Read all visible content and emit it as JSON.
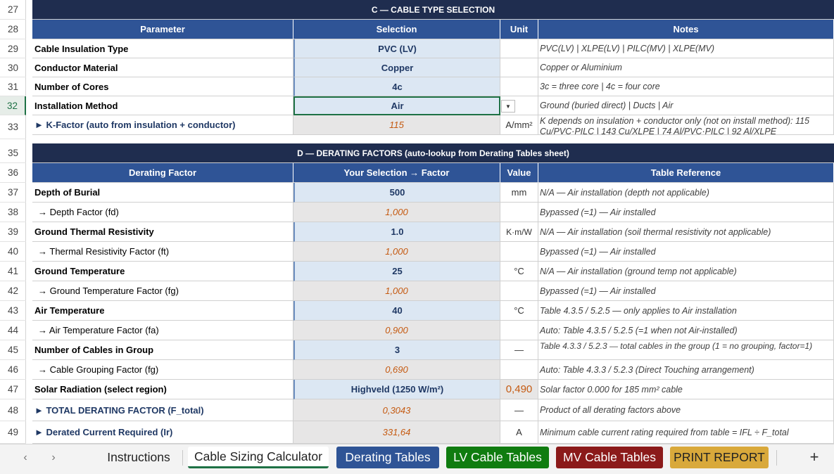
{
  "row_numbers": [
    "27",
    "28",
    "29",
    "30",
    "31",
    "32",
    "33",
    "35",
    "36",
    "37",
    "38",
    "39",
    "40",
    "41",
    "42",
    "43",
    "44",
    "45",
    "46",
    "47",
    "48",
    "49"
  ],
  "section_c": {
    "title": "C  —  CABLE TYPE SELECTION",
    "headers": [
      "Parameter",
      "Selection",
      "Unit",
      "Notes"
    ],
    "rows": [
      {
        "param": "Cable Insulation Type",
        "selection": "PVC (LV)",
        "unit": "",
        "notes": "PVC(LV) | XLPE(LV) | PILC(MV) | XLPE(MV)"
      },
      {
        "param": "Conductor Material",
        "selection": "Copper",
        "unit": "",
        "notes": "Copper or Aluminium"
      },
      {
        "param": "Number of Cores",
        "selection": "4c",
        "unit": "",
        "notes": "3c = three core  |  4c = four core"
      },
      {
        "param": "Installation Method",
        "selection": "Air",
        "unit": "",
        "notes": "Ground (buried direct)  |  Ducts  |  Air"
      },
      {
        "param": "► K-Factor  (auto from insulation + conductor)",
        "selection": "115",
        "unit": "A/mm²",
        "notes": "K depends on insulation + conductor only (not on install method):  115 Cu/PVC·PILC  |  143 Cu/XLPE  |  74 Al/PVC·PILC  |  92 Al/XLPE"
      }
    ]
  },
  "section_d": {
    "title": "D  —  DERATING FACTORS  (auto-lookup from Derating Tables sheet)",
    "headers": [
      "Derating Factor",
      "Your Selection → Factor",
      "Value",
      "Table Reference"
    ],
    "rows": [
      {
        "param": "Depth of Burial",
        "selection": "500",
        "unit": "mm",
        "notes": "N/A — Air installation (depth not applicable)",
        "kind": "input"
      },
      {
        "param": "→ Depth Factor  (fd)",
        "selection": "1,000",
        "unit": "",
        "notes": "Bypassed (=1) — Air installed",
        "kind": "calc"
      },
      {
        "param": "Ground Thermal Resistivity",
        "selection": "1.0",
        "unit": "K·m/W",
        "notes": "N/A — Air installation (soil thermal resistivity not applicable)",
        "kind": "input"
      },
      {
        "param": "→ Thermal Resistivity Factor  (ft)",
        "selection": "1,000",
        "unit": "",
        "notes": "Bypassed (=1) — Air installed",
        "kind": "calc"
      },
      {
        "param": "Ground Temperature",
        "selection": "25",
        "unit": "°C",
        "notes": "N/A — Air installation (ground temp not applicable)",
        "kind": "input"
      },
      {
        "param": "→ Ground Temperature Factor  (fg)",
        "selection": "1,000",
        "unit": "",
        "notes": "Bypassed (=1) — Air installed",
        "kind": "calc"
      },
      {
        "param": "Air Temperature",
        "selection": "40",
        "unit": "°C",
        "notes": "Table 4.3.5 / 5.2.5 — only applies to Air installation",
        "kind": "input"
      },
      {
        "param": "→ Air Temperature Factor  (fa)",
        "selection": "0,900",
        "unit": "",
        "notes": "Auto: Table 4.3.5 / 5.2.5  (=1 when not Air-installed)",
        "kind": "calc"
      },
      {
        "param": "Number of Cables in Group",
        "selection": "3",
        "unit": "—",
        "notes": "Table 4.3.3 / 5.2.3 — total cables in the group (1 = no grouping, factor=1)",
        "kind": "input"
      },
      {
        "param": "→ Cable Grouping Factor  (fg)",
        "selection": "0,690",
        "unit": "",
        "notes": "Auto: Table 4.3.3 / 5.2.3  (Direct Touching arrangement)",
        "kind": "calc"
      },
      {
        "param": "Solar Radiation  (select region)",
        "selection": "Highveld (1250 W/m²)",
        "unit": "0,490",
        "notes": "Solar factor 0.000  for 185 mm² cable",
        "kind": "solar"
      },
      {
        "param": "► TOTAL DERATING FACTOR  (F_total)",
        "selection": "0,3043",
        "unit": "—",
        "notes": "Product of all derating factors above",
        "kind": "total"
      },
      {
        "param": "► Derated Current Required  (Ir)",
        "selection": "331,64",
        "unit": "A",
        "notes": "Minimum cable current rating required from table  =  IFL ÷ F_total",
        "kind": "total"
      }
    ]
  },
  "tabs": {
    "nav_prev": "‹",
    "nav_next": "›",
    "items": [
      {
        "label": "Instructions",
        "color": "plain"
      },
      {
        "label": "Cable Sizing Calculator",
        "color": "active"
      },
      {
        "label": "Derating Tables",
        "color": "#2f5496"
      },
      {
        "label": "LV Cable Tables",
        "color": "#107c10"
      },
      {
        "label": "MV Cable Tables",
        "color": "#8b1a1a"
      },
      {
        "label": "PRINT REPORT",
        "color": "#d9a93b"
      }
    ],
    "add": "+"
  },
  "dropdown_icon": "chevron-down-icon"
}
